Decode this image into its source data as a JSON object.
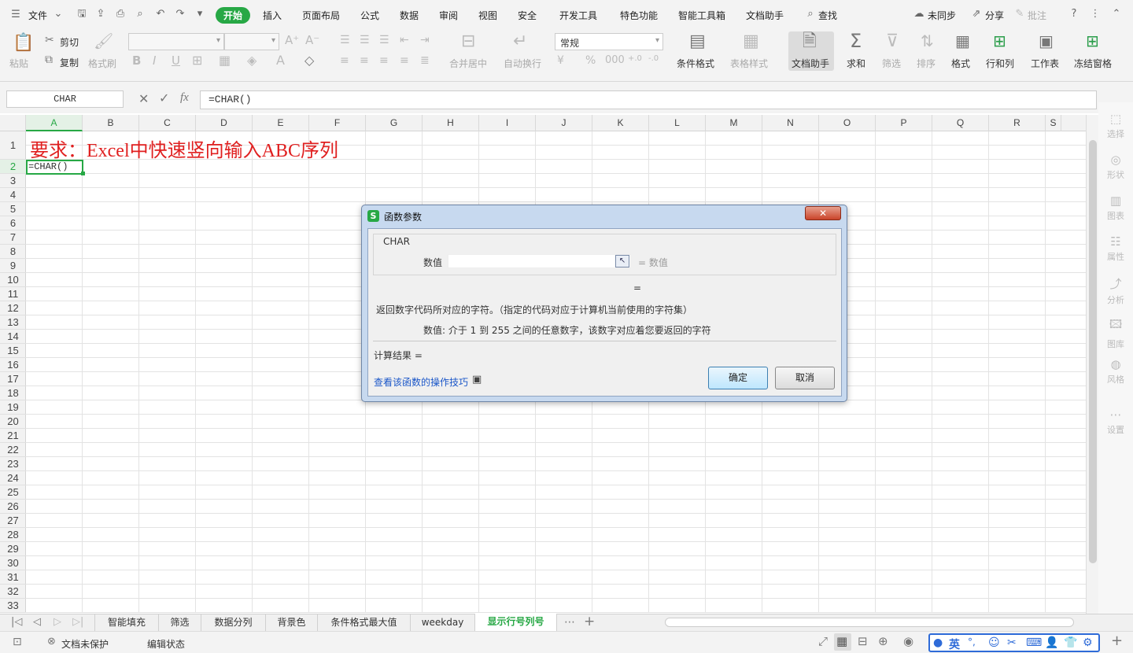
{
  "topbar": {
    "file": "文件",
    "menus": [
      "开始",
      "插入",
      "页面布局",
      "公式",
      "数据",
      "审阅",
      "视图",
      "安全",
      "开发工具",
      "特色功能",
      "智能工具箱",
      "文档助手",
      "查找"
    ],
    "sync": "未同步",
    "share": "分享",
    "annotate": "批注"
  },
  "ribbon": {
    "paste": "粘贴",
    "cut": "剪切",
    "copy": "复制",
    "format_painter": "格式刷",
    "merge_center": "合并居中",
    "wrap_text": "自动换行",
    "number_format": "常规",
    "cond_format": "条件格式",
    "table_style": "表格样式",
    "doc_assistant": "文档助手",
    "sum": "求和",
    "filter": "筛选",
    "sort": "排序",
    "format": "格式",
    "row_col": "行和列",
    "worksheet": "工作表",
    "freeze": "冻结窗格"
  },
  "formula_bar": {
    "name_box": "CHAR",
    "fx": "fx",
    "formula": "=CHAR()"
  },
  "grid": {
    "columns": [
      "A",
      "B",
      "C",
      "D",
      "E",
      "F",
      "G",
      "H",
      "I",
      "J",
      "K",
      "L",
      "M",
      "N",
      "O",
      "P",
      "Q",
      "R",
      "S"
    ],
    "rows": [
      "1",
      "2",
      "3",
      "4",
      "5",
      "6",
      "7",
      "8",
      "9",
      "10",
      "11",
      "12",
      "13",
      "14",
      "15",
      "16",
      "17",
      "18",
      "19",
      "20",
      "21",
      "22",
      "23",
      "24",
      "25",
      "26",
      "27",
      "28",
      "29",
      "30",
      "31",
      "32",
      "33"
    ],
    "a1": "要求：Excel中快速竖向输入ABC序列",
    "a2": "=CHAR()"
  },
  "right_panel": [
    "选择",
    "形状",
    "图表",
    "属性",
    "分析",
    "图库",
    "风格",
    "设置"
  ],
  "dialog": {
    "title": "函数参数",
    "func": "CHAR",
    "arg_label": "数值",
    "arg_value": "",
    "arg_hint": "= 数值",
    "eq": "=",
    "description": "返回数字代码所对应的字符。（指定的代码对应于计算机当前使用的字符集）",
    "arg_desc": "数值:  介于 1 到 255 之间的任意数字，该数字对应着您要返回的字符",
    "result": "计算结果 =",
    "link": "查看该函数的操作技巧",
    "ok": "确定",
    "cancel": "取消"
  },
  "sheet_tabs": [
    "智能填充",
    "筛选",
    "数据分列",
    "背景色",
    "条件格式最大值",
    "weekday",
    "显示行号列号"
  ],
  "status": {
    "protect": "文档未保护",
    "mode": "编辑状态",
    "ime": "英"
  },
  "colors": {
    "accent": "#27a845",
    "red_text": "#e02020",
    "link": "#1a56c8"
  }
}
